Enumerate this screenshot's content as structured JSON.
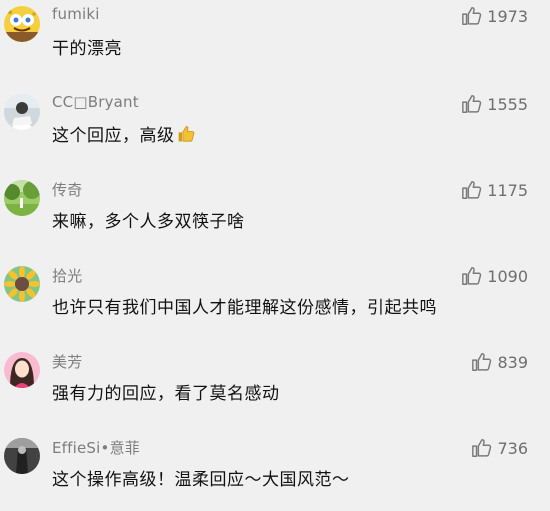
{
  "comments": [
    {
      "username": "fumiki",
      "text": "干的漂亮",
      "likes": "1973",
      "avatar_icon": "sponge-cartoon-avatar"
    },
    {
      "username": "CC□Bryant",
      "text": "这个回应，高级",
      "likes": "1555",
      "avatar_icon": "person-photo-avatar",
      "emoji": "thumbs-up-emoji"
    },
    {
      "username": "传奇",
      "text": "来嘛，多个人多双筷子啥",
      "likes": "1175",
      "avatar_icon": "landscape-photo-avatar"
    },
    {
      "username": "拾光",
      "text": "也许只有我们中国人才能理解这份感情，引起共鸣",
      "likes": "1090",
      "avatar_icon": "sunflower-avatar"
    },
    {
      "username": "美芳",
      "text": "强有力的回应，看了莫名感动",
      "likes": "839",
      "avatar_icon": "woman-portrait-avatar"
    },
    {
      "username": "EffieSi•意菲",
      "text": "这个操作高级！温柔回应～大国风范～",
      "likes": "736",
      "avatar_icon": "dark-figure-avatar"
    }
  ],
  "colors": {
    "background": "#f0f0f0",
    "username": "#7d7d7d",
    "text": "#111111",
    "likes": "#6e6e6e",
    "emoji": "#e8b62a"
  }
}
